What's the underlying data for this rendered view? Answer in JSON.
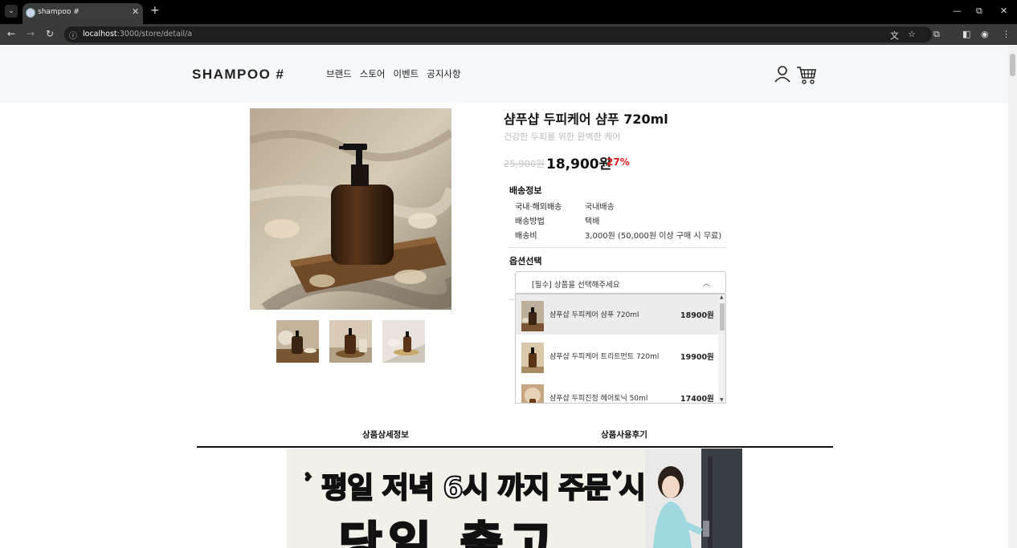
{
  "browser": {
    "tab_title": "shampoo #",
    "tab_close": "✕",
    "new_tab": "+",
    "url_host": "localhost",
    "url_path": ":3000/store/detail/a",
    "win_minimize": "—",
    "win_restore": "⧉",
    "win_close": "✕"
  },
  "header": {
    "logo": "SHAMPOO #",
    "nav": [
      "브랜드",
      "스토어",
      "이벤트",
      "공지사항"
    ]
  },
  "product": {
    "title": "샴푸샵 두피케어 샴푸 720ml",
    "subtitle": "건강한 두피를 위한 완벽한 케어",
    "original_price": "25,900원",
    "price": "18,900원",
    "discount": "27%"
  },
  "shipping": {
    "heading": "배송정보",
    "rows": [
      {
        "label": "국내·해외배송",
        "value": "국내배송"
      },
      {
        "label": "배송방법",
        "value": "택배"
      },
      {
        "label": "배송비",
        "value": "3,000원 (50,000원 이상 구매 시 무료)"
      }
    ]
  },
  "options": {
    "heading": "옵션선택",
    "placeholder": "[필수] 상품을 선택해주세요",
    "items": [
      {
        "name": "샴푸샵 두피케어 샴푸 720ml",
        "price": "18900원"
      },
      {
        "name": "샴푸샵 두피케어 트리트먼트 720ml",
        "price": "19900원"
      },
      {
        "name": "샴푸샵 두피진정 헤어토닉 50ml",
        "price": "17400원"
      }
    ]
  },
  "detail_tabs": [
    "상품상세정보",
    "상품사용후기"
  ],
  "banner": {
    "line1": "평일 저녁 6시 까지 주문 시",
    "line2": "당일 출고"
  }
}
